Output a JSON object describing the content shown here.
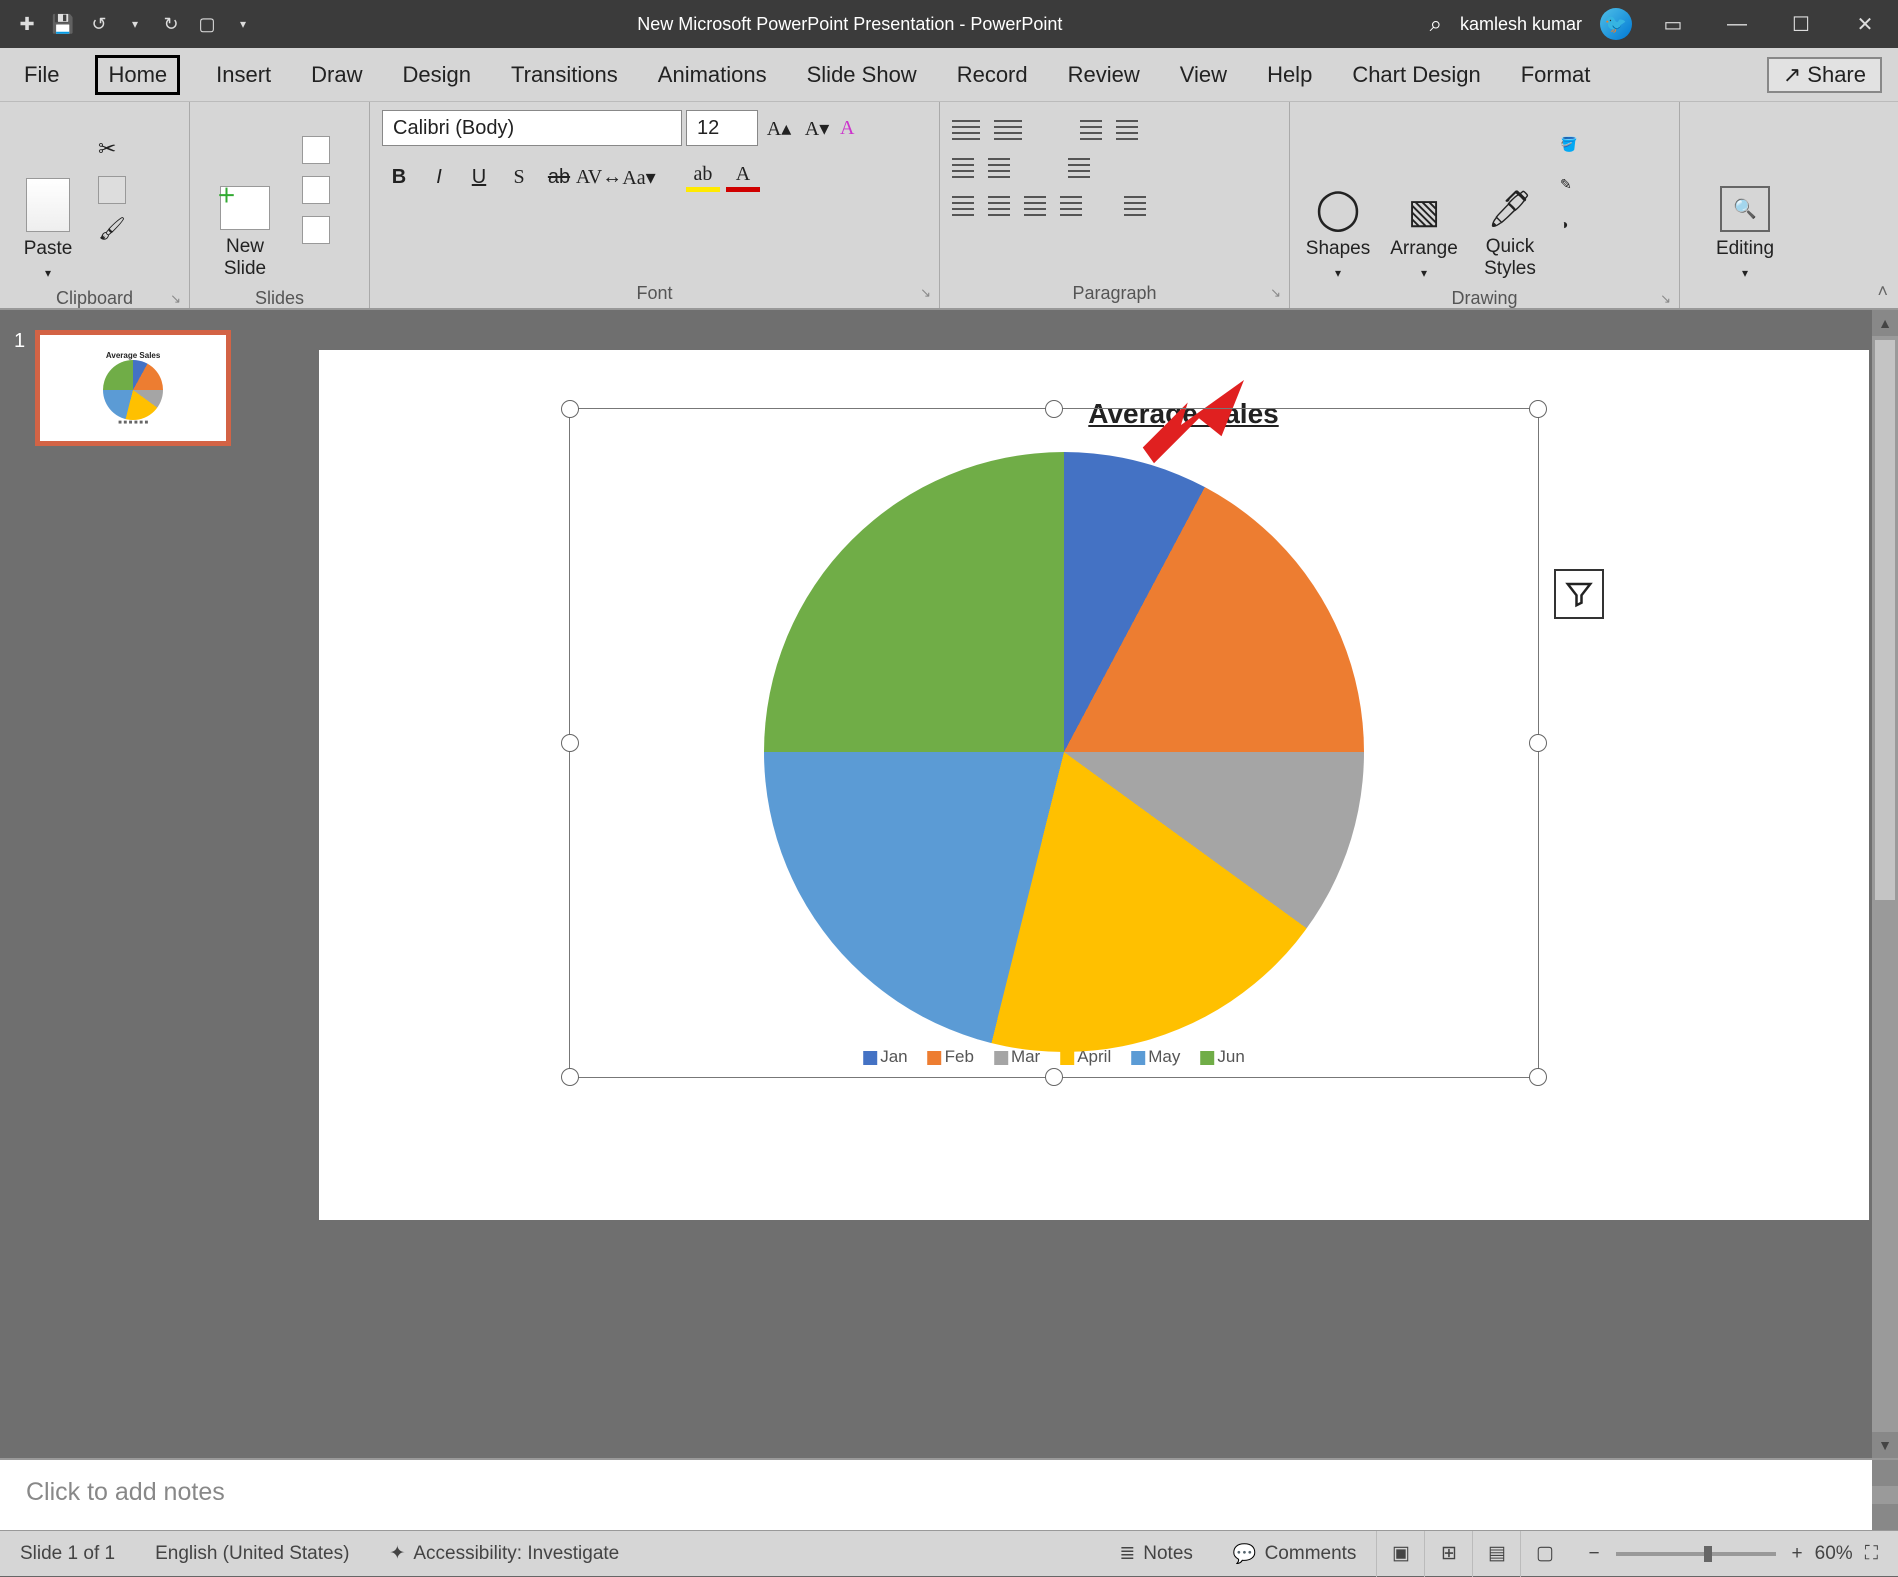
{
  "titlebar": {
    "doc_title": "New Microsoft PowerPoint Presentation  -  PowerPoint",
    "user_name": "kamlesh kumar"
  },
  "tabs": {
    "file": "File",
    "home": "Home",
    "insert": "Insert",
    "draw": "Draw",
    "design": "Design",
    "transitions": "Transitions",
    "animations": "Animations",
    "slideshow": "Slide Show",
    "record": "Record",
    "review": "Review",
    "view": "View",
    "help": "Help",
    "chart_design": "Chart Design",
    "format": "Format",
    "share": "Share"
  },
  "ribbon": {
    "clipboard": {
      "label": "Clipboard",
      "paste": "Paste"
    },
    "slides": {
      "label": "Slides",
      "new_slide": "New\nSlide"
    },
    "font": {
      "label": "Font",
      "font_name": "Calibri (Body)",
      "font_size": "12"
    },
    "paragraph": {
      "label": "Paragraph"
    },
    "drawing": {
      "label": "Drawing",
      "shapes": "Shapes",
      "arrange": "Arrange",
      "quick_styles": "Quick\nStyles"
    },
    "editing": {
      "label": "Editing",
      "editing_btn": "Editing"
    }
  },
  "thumbs": {
    "n1": "1"
  },
  "slide": {
    "chart_title": "Average Sales",
    "legend": {
      "jan": "Jan",
      "feb": "Feb",
      "mar": "Mar",
      "april": "April",
      "may": "May",
      "jun": "Jun"
    }
  },
  "notes": {
    "placeholder": "Click to add notes"
  },
  "status": {
    "slide_of": "Slide 1 of 1",
    "language": "English (United States)",
    "accessibility": "Accessibility: Investigate",
    "notes_btn": "Notes",
    "comments_btn": "Comments",
    "zoom": "60%"
  },
  "chart_data": {
    "type": "pie",
    "title": "Average Sales",
    "categories": [
      "Jan",
      "Feb",
      "Mar",
      "April",
      "May",
      "Jun"
    ],
    "values": [
      8,
      17,
      10,
      19,
      21,
      25
    ],
    "colors": [
      "#4472c4",
      "#ed7d31",
      "#a5a5a5",
      "#ffc000",
      "#5b9bd5",
      "#70ad47"
    ],
    "legend_position": "bottom"
  }
}
